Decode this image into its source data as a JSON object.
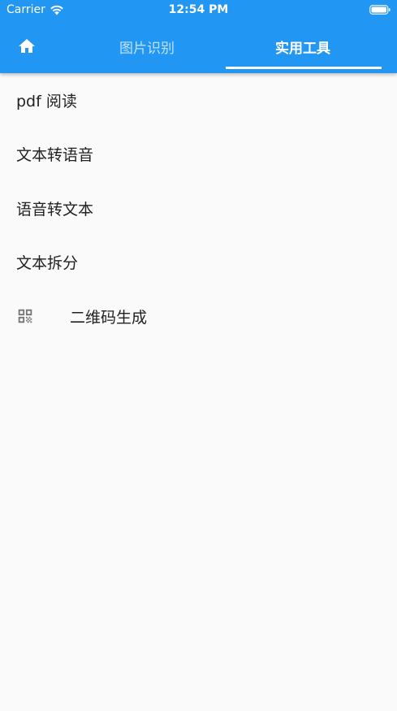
{
  "status_bar": {
    "carrier": "Carrier",
    "time": "12:54 PM",
    "wifi_icon": "wifi-icon",
    "battery_icon": "battery-full-icon"
  },
  "app_bar": {
    "color": "#2196f3",
    "home_icon": "home-icon",
    "tabs": [
      {
        "label": "图片识别",
        "selected": false
      },
      {
        "label": "实用工具",
        "selected": true
      }
    ]
  },
  "tools": [
    {
      "label": "pdf 阅读",
      "icon": null
    },
    {
      "label": "文本转语音",
      "icon": null
    },
    {
      "label": "语音转文本",
      "icon": null
    },
    {
      "label": "文本拆分",
      "icon": null
    },
    {
      "label": "二维码生成",
      "icon": "qr-code-icon"
    }
  ]
}
